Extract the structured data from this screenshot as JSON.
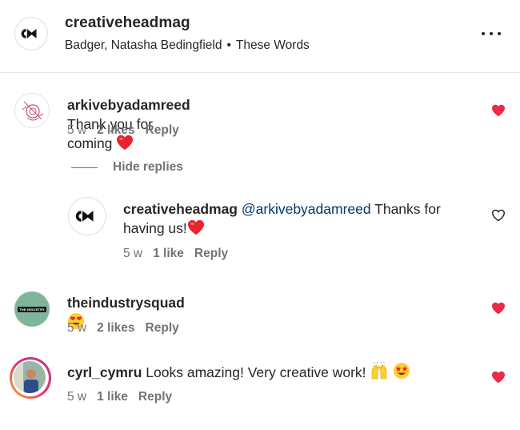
{
  "header": {
    "username": "creativeheadmag",
    "artist": "Badger, Natasha Bedingfield",
    "separator": "•",
    "track": "These Words"
  },
  "comments": [
    {
      "username": "arkivebyadamreed",
      "text": "Thank you for coming",
      "time": "5 w",
      "likes": "2 likes",
      "reply_label": "Reply",
      "liked": true
    },
    {
      "username": "creativeheadmag",
      "mention": "@arkivebyadamreed",
      "text_line1": "Thanks for",
      "text_line2": "having us!",
      "time": "5 w",
      "likes": "1 like",
      "reply_label": "Reply",
      "liked": false
    },
    {
      "username": "theindustrysquad",
      "text": "",
      "avatar_text": "THE INDUSTRY",
      "time": "5 w",
      "likes": "2 likes",
      "reply_label": "Reply",
      "liked": true
    },
    {
      "username": "cyrl_cymru",
      "text": "Looks amazing! Very creative work!",
      "time": "5 w",
      "likes": "1 like",
      "reply_label": "Reply",
      "liked": true
    }
  ],
  "hide_replies_label": "Hide replies",
  "colors": {
    "like_red": "#ed2a45",
    "mention_blue": "#00376b",
    "meta_gray": "#737373",
    "squad_green": "#7fb59a"
  },
  "icons": [
    "more-icon",
    "heart-filled-icon",
    "heart-outline-icon",
    "red-heart-emoji",
    "heart-eyes-emoji",
    "raising-hands-emoji",
    "star-struck-emoji"
  ]
}
